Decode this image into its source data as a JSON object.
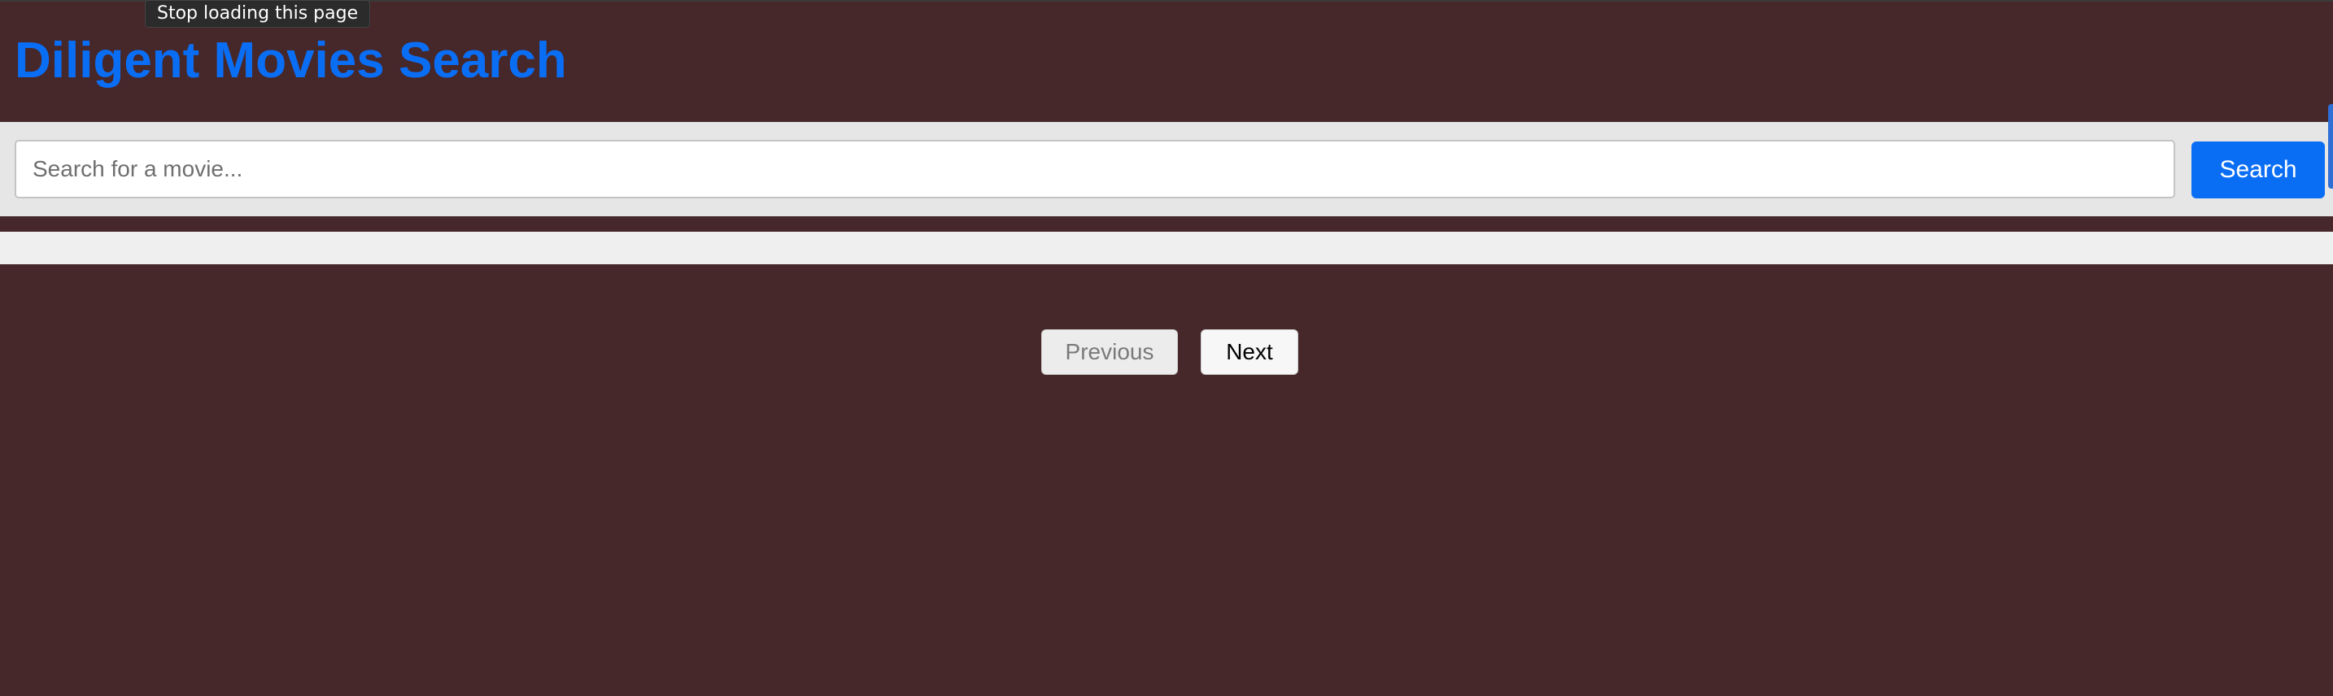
{
  "tooltip": {
    "text": "Stop loading this page"
  },
  "header": {
    "title": "Diligent Movies Search"
  },
  "search": {
    "placeholder": "Search for a movie...",
    "value": "",
    "button_label": "Search"
  },
  "pagination": {
    "previous_label": "Previous",
    "next_label": "Next",
    "previous_disabled": true
  },
  "colors": {
    "page_background": "#46272a",
    "accent": "#0a6ef5",
    "search_bar_background": "#e6e6e6",
    "results_strip_background": "#f0efef"
  }
}
